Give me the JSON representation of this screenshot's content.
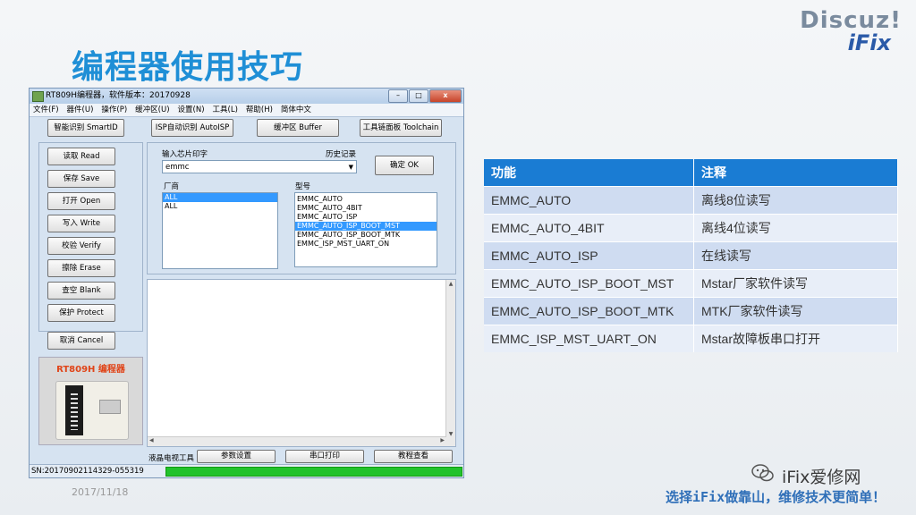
{
  "slide": {
    "title": "编程器使用技巧",
    "date": "2017/11/18",
    "logo_line1": "Discuz!",
    "logo_line2": "iFix",
    "watermark": "iFix爱修网",
    "slogan": "选择iFix做靠山，维修技术更简单！"
  },
  "window": {
    "title": "RT809H编程器，软件版本：20170928",
    "controls": {
      "minimize": "–",
      "maximize": "□",
      "close": "x"
    },
    "menu": [
      "文件(F)",
      "器件(U)",
      "操作(P)",
      "缓冲区(U)",
      "设置(N)",
      "工具(L)",
      "帮助(H)",
      "简体中文"
    ],
    "toolbar": {
      "smartid": "智能识别 SmartID",
      "autoisp": "ISP自动识别 AutoISP",
      "buffer": "缓冲区 Buffer",
      "toolchain": "工具链面板 Toolchain"
    },
    "side_buttons": [
      "读取 Read",
      "保存 Save",
      "打开 Open",
      "写入 Write",
      "校验 Verify",
      "擦除 Erase",
      "查空 Blank",
      "保护 Protect"
    ],
    "cancel_button": "取消 Cancel",
    "search": {
      "label": "输入芯片印字",
      "history_label": "历史记录",
      "value": "emmc",
      "ok_button": "确定 OK"
    },
    "manufacturer": {
      "label": "厂商",
      "items": [
        "ALL",
        "ALL"
      ],
      "selected_index": 0
    },
    "model": {
      "label": "型号",
      "items": [
        "EMMC_AUTO",
        "EMMC_AUTO_4BIT",
        "EMMC_AUTO_ISP",
        "EMMC_AUTO_ISP_BOOT_MST",
        "EMMC_AUTO_ISP_BOOT_MTK",
        "EMMC_ISP_MST_UART_ON"
      ],
      "selected_index": 3
    },
    "device_caption": "RT809H 编程器",
    "bottom_bar": {
      "label": "液晶电视工具",
      "params": "参数设置",
      "serial": "串口打印",
      "tutorial": "教程查看"
    },
    "status": {
      "sn": "SN:20170902114329-055319",
      "progress": 1.0
    }
  },
  "table": {
    "headers": [
      "功能",
      "注释"
    ],
    "rows": [
      [
        "EMMC_AUTO",
        "离线8位读写"
      ],
      [
        "EMMC_AUTO_4BIT",
        "离线4位读写"
      ],
      [
        "EMMC_AUTO_ISP",
        "在线读写"
      ],
      [
        "EMMC_AUTO_ISP_BOOT_MST",
        "Mstar厂家软件读写"
      ],
      [
        "EMMC_AUTO_ISP_BOOT_MTK",
        "MTK厂家软件读写"
      ],
      [
        "EMMC_ISP_MST_UART_ON",
        "Mstar故障板串口打开"
      ]
    ]
  },
  "colors": {
    "title": "#1f8fd6",
    "table_header": "#1a7cd3",
    "table_row_odd": "#cfdcf1",
    "table_row_even": "#e8eef8",
    "progress": "#22c22c",
    "selection": "#3399ff"
  }
}
